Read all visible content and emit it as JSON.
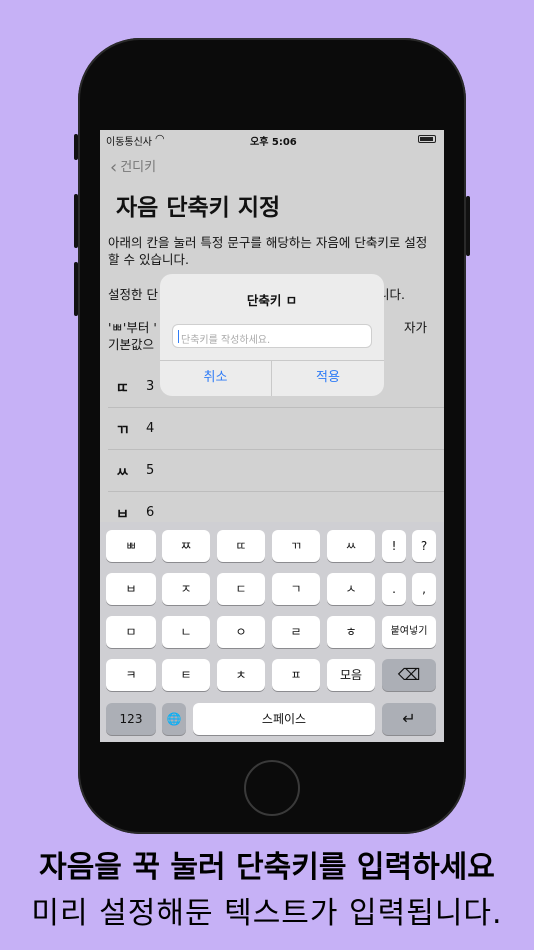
{
  "status": {
    "carrier": "이동통신사",
    "time": "오후 5:06"
  },
  "nav": {
    "back_label": "건디키"
  },
  "page": {
    "title": "자음 단축키 지정",
    "para1": "아래의 칸을 눌러 특정 문구를 해당하는 자음에 단축키로 설정할 수 있습니다.",
    "para2_left": "설정한 단",
    "para2_right": "니다.",
    "para3_left_line1": "'ㅃ'부터 '",
    "para3_right_line1": "자가",
    "para3_left_line2": "기본값으"
  },
  "rows": [
    {
      "key": "ㄸ",
      "value": "3"
    },
    {
      "key": "ㄲ",
      "value": "4"
    },
    {
      "key": "ㅆ",
      "value": "5"
    },
    {
      "key": "ㅂ",
      "value": "6"
    }
  ],
  "alert": {
    "title": "단축키 ㅁ",
    "placeholder": "단축키를 작성하세요.",
    "cancel": "취소",
    "apply": "적용"
  },
  "keyboard": {
    "row1": [
      "ㅃ",
      "ㅉ",
      "ㄸ",
      "ㄲ",
      "ㅆ",
      "!",
      "?"
    ],
    "row2": [
      "ㅂ",
      "ㅈ",
      "ㄷ",
      "ㄱ",
      "ㅅ",
      ".",
      ","
    ],
    "row3": [
      "ㅁ",
      "ㄴ",
      "ㅇ",
      "ㄹ",
      "ㅎ",
      "붙여넣기"
    ],
    "row4": [
      "ㅋ",
      "ㅌ",
      "ㅊ",
      "ㅍ",
      "모음",
      "⌫"
    ],
    "row5": [
      "123",
      "🌐",
      "스페이스",
      "↵"
    ]
  },
  "captions": {
    "line1": "자음을 꾹 눌러 단축키를 입력하세요",
    "line2": "미리 설정해둔 텍스트가 입력됩니다."
  }
}
